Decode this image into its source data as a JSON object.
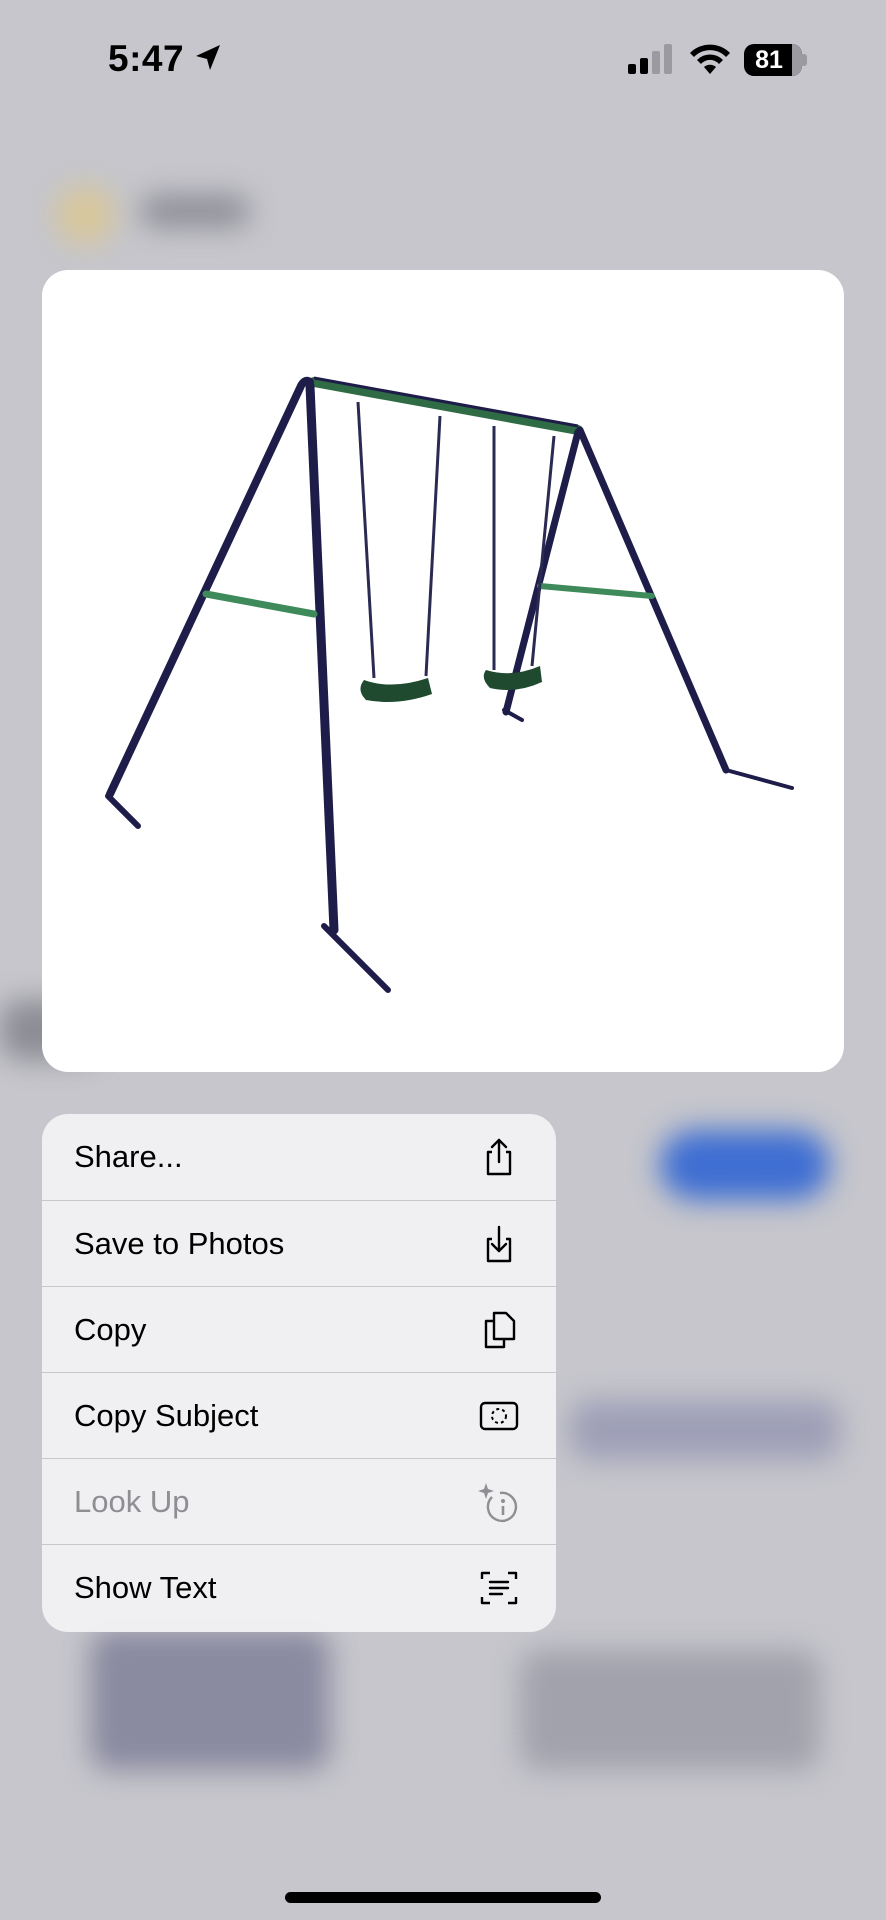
{
  "status_bar": {
    "time": "5:47",
    "battery": "81",
    "icons": [
      "location-arrow-icon",
      "cellular-signal-icon",
      "wifi-icon",
      "battery-icon"
    ]
  },
  "preview": {
    "description_icon": "swing-set-image"
  },
  "menu": {
    "items": [
      {
        "label": "Share...",
        "icon": "share-icon",
        "enabled": true
      },
      {
        "label": "Save to Photos",
        "icon": "save-to-photos-icon",
        "enabled": true
      },
      {
        "label": "Copy",
        "icon": "copy-icon",
        "enabled": true
      },
      {
        "label": "Copy Subject",
        "icon": "copy-subject-icon",
        "enabled": true
      },
      {
        "label": "Look Up",
        "icon": "look-up-icon",
        "enabled": false
      },
      {
        "label": "Show Text",
        "icon": "show-text-icon",
        "enabled": true
      }
    ]
  },
  "colors": {
    "frame": "#1e1d4a",
    "bar": "#2f6b45",
    "seat": "#1f4a30",
    "accent_blue": "#3e6ed2"
  }
}
